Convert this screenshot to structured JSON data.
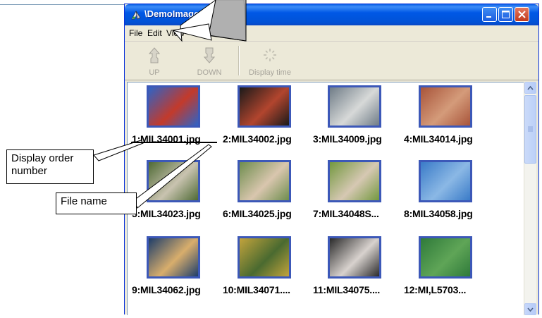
{
  "window": {
    "title": "\\DemoImage",
    "menu": [
      "File",
      "Edit",
      "View"
    ],
    "toolbar": [
      {
        "label": "UP",
        "icon": "up-hand-icon"
      },
      {
        "label": "DOWN",
        "icon": "down-hand-icon"
      },
      {
        "label": "Display time",
        "icon": "display-time-icon"
      }
    ]
  },
  "thumbnails": [
    {
      "label": "1:MIL34001.jpg",
      "colors": [
        "#2e63c6",
        "#c33a2b"
      ]
    },
    {
      "label": "2:MIL34002.jpg",
      "colors": [
        "#1a1a1a",
        "#b2452e"
      ]
    },
    {
      "label": "3:MIL34009.jpg",
      "colors": [
        "#6f7c87",
        "#d7d9d8"
      ]
    },
    {
      "label": "4:MIL34014.jpg",
      "colors": [
        "#a8543a",
        "#d49b7a"
      ]
    },
    {
      "label": "5:MIL34023.jpg",
      "colors": [
        "#4f6a35",
        "#c9c3b0"
      ]
    },
    {
      "label": "6:MIL34025.jpg",
      "colors": [
        "#6e8d4e",
        "#d9c6ae"
      ]
    },
    {
      "label": "7:MIL34048S...",
      "colors": [
        "#73983f",
        "#d6c8b3"
      ]
    },
    {
      "label": "8:MIL34058.jpg",
      "colors": [
        "#3a7bc8",
        "#8bb8e5"
      ]
    },
    {
      "label": "9:MIL34062.jpg",
      "colors": [
        "#1d3d6a",
        "#d8ae6c"
      ]
    },
    {
      "label": "10:MIL34071....",
      "colors": [
        "#c2a33c",
        "#4a6a30"
      ]
    },
    {
      "label": "11:MIL34075....",
      "colors": [
        "#2a2a2a",
        "#d8d2ce"
      ]
    },
    {
      "label": "12:MI,L5703...",
      "colors": [
        "#2f7a3a",
        "#5fa557"
      ]
    }
  ],
  "callouts": {
    "display_order": "Display order number",
    "file_name": "File name"
  }
}
